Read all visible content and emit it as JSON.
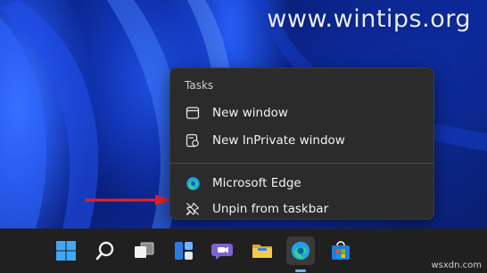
{
  "watermark": "www.wintips.org",
  "footer_watermark": "wsxdn.com",
  "menu": {
    "header": "Tasks",
    "items": [
      {
        "label": "New window",
        "icon": "window-icon"
      },
      {
        "label": "New InPrivate window",
        "icon": "inprivate-icon"
      },
      {
        "label": "Microsoft Edge",
        "icon": "edge-icon"
      },
      {
        "label": "Unpin from taskbar",
        "icon": "unpin-icon"
      }
    ]
  },
  "annotation": {
    "arrow_color": "#e0242f"
  },
  "taskbar": {
    "icons": [
      "windows-start-icon",
      "search-icon",
      "task-view-icon",
      "widgets-icon",
      "teams-chat-icon",
      "file-explorer-icon",
      "edge-icon",
      "microsoft-store-icon"
    ],
    "active_icon": "edge-icon"
  }
}
